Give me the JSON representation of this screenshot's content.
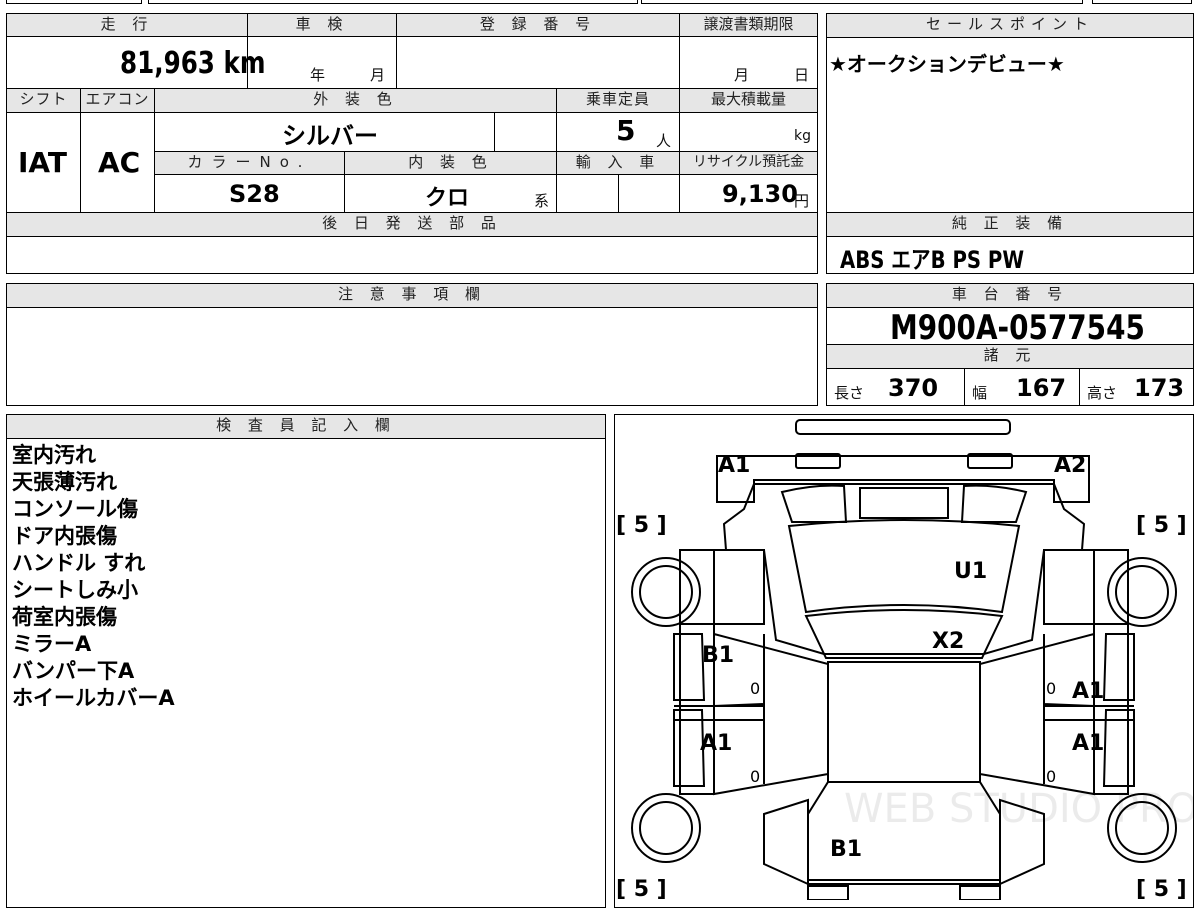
{
  "header_row": {
    "mileage_label": "走 行",
    "mileage_value": "81,963 km",
    "inspection_label": "車 検",
    "inspection_year": "年",
    "inspection_month": "月",
    "registration_label": "登 録 番 号",
    "registration_value": "",
    "transfer_label": "譲渡書類期限",
    "transfer_month": "月",
    "transfer_day": "日"
  },
  "spec_row": {
    "shift_label": "シフト",
    "shift_value": "IAT",
    "ac_label": "エアコン",
    "ac_value": "AC",
    "exterior_label": "外 装 色",
    "exterior_value": "シルバー",
    "capacity_label": "乗車定員",
    "capacity_value": "5",
    "capacity_unit": "人",
    "load_label": "最大積載量",
    "load_unit": "kg",
    "color_no_label": "カラーNo.",
    "color_no_value": "S28",
    "interior_label": "内 装 色",
    "interior_value": "クロ",
    "interior_unit": "系",
    "import_label": "輸 入 車",
    "recycle_label": "リサイクル預託金",
    "recycle_value": "9,130",
    "recycle_unit": "円"
  },
  "later_parts": {
    "label": "後 日 発 送 部 品"
  },
  "notes": {
    "label": "注 意 事 項 欄"
  },
  "sales_point": {
    "label": "セールスポイント",
    "text": "★オークションデビュー★"
  },
  "equipment": {
    "label": "純 正 装 備",
    "text": "ABS エアB PS PW"
  },
  "chassis": {
    "label": "車 台 番 号",
    "value": "M900A-0577545"
  },
  "dimensions": {
    "label": "諸 元",
    "length_label": "長さ",
    "length_value": "370",
    "width_label": "幅",
    "width_value": "167",
    "height_label": "高さ",
    "height_value": "173"
  },
  "inspector": {
    "label": "検 査 員 記 入 欄",
    "remarks": [
      "室内汚れ",
      "天張薄汚れ",
      "コンソール傷",
      "ドア内張傷",
      "ハンドル すれ",
      "シートしみ小",
      "荷室内張傷",
      "ミラーA",
      "バンパー下A",
      "ホイールカバーA"
    ]
  },
  "diagram": {
    "front_left": "A1",
    "front_right": "A2",
    "roof": "U1",
    "windshield_lower": "X2",
    "left_front_door": "B1",
    "left_rear_door": "A1",
    "right_front_door": "A1",
    "right_rear_door": "A1",
    "rear": "B1",
    "tire_fl": "[ 5 ]",
    "tire_fr": "[ 5 ]",
    "tire_rl": "[ 5 ]",
    "tire_rr": "[ 5 ]",
    "door_zero_1": "0",
    "door_zero_2": "0",
    "door_zero_3": "0",
    "door_zero_4": "0",
    "watermark": "WEB STUDIO PRO"
  }
}
